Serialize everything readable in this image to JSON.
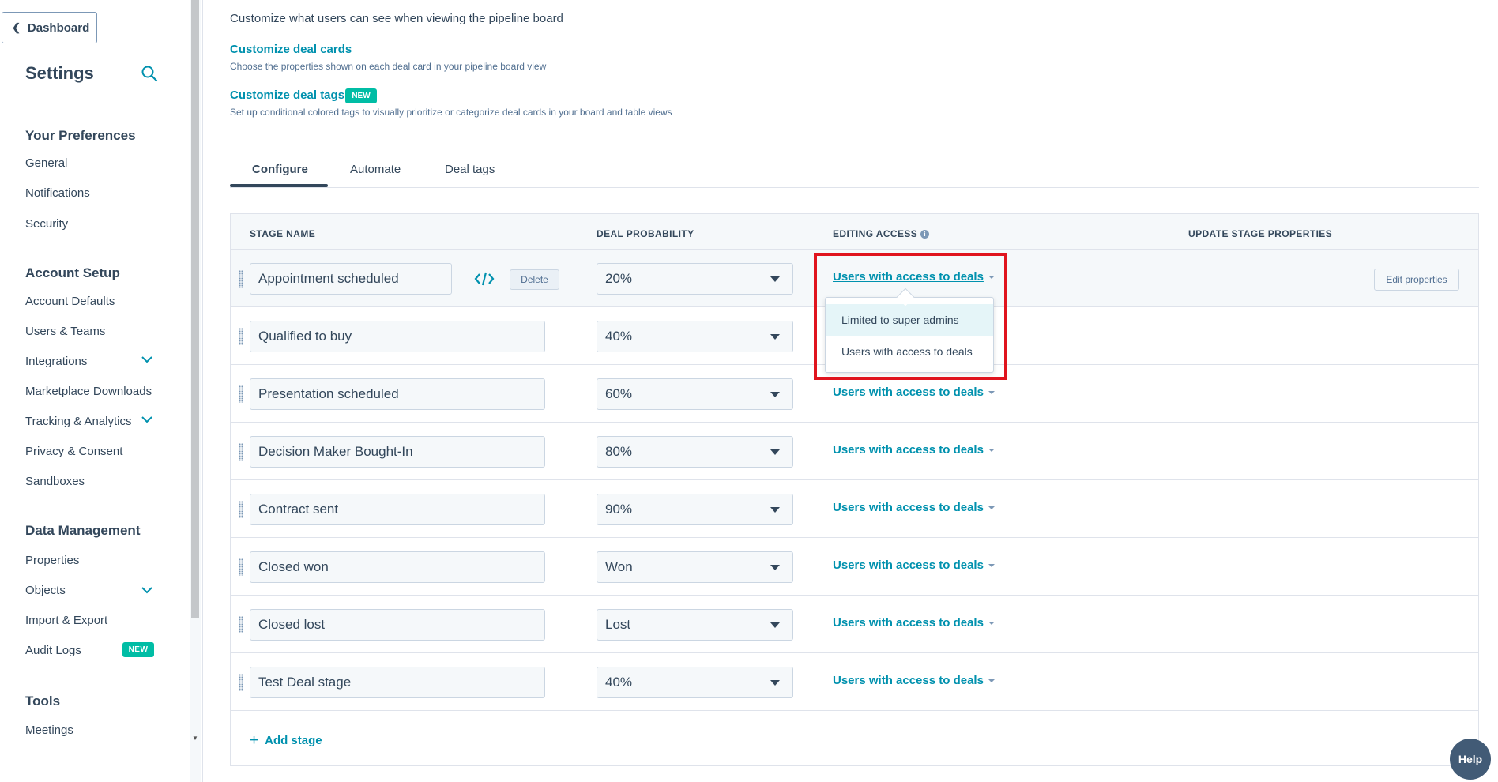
{
  "sidebar": {
    "back_label": "Dashboard",
    "title": "Settings",
    "sections": [
      {
        "title": "Your Preferences",
        "items": [
          "General",
          "Notifications",
          "Security"
        ]
      },
      {
        "title": "Account Setup",
        "items": [
          "Account Defaults",
          "Users & Teams",
          "Integrations",
          "Marketplace Downloads",
          "Tracking & Analytics",
          "Privacy & Consent",
          "Sandboxes"
        ]
      },
      {
        "title": "Data Management",
        "items": [
          "Properties",
          "Objects",
          "Import & Export",
          "Audit Logs"
        ]
      },
      {
        "title": "Tools",
        "items": [
          "Meetings"
        ]
      }
    ],
    "new_badge": "NEW"
  },
  "main": {
    "intro": "Customize what users can see when viewing the pipeline board",
    "customize_cards_title": "Customize deal cards",
    "customize_cards_desc": "Choose the properties shown on each deal card in your pipeline board view",
    "customize_tags_title": "Customize deal tags",
    "customize_tags_badge": "NEW",
    "customize_tags_desc": "Set up conditional colored tags to visually prioritize or categorize deal cards in your board and table views",
    "tabs": [
      "Configure",
      "Automate",
      "Deal tags"
    ],
    "table": {
      "headers": [
        "STAGE NAME",
        "DEAL PROBABILITY",
        "EDITING ACCESS",
        "UPDATE STAGE PROPERTIES"
      ],
      "rows": [
        {
          "stage": "Appointment scheduled",
          "probability": "20%",
          "access": "Users with access to deals"
        },
        {
          "stage": "Qualified to buy",
          "probability": "40%",
          "access": "Users with access to deals"
        },
        {
          "stage": "Presentation scheduled",
          "probability": "60%",
          "access": "Users with access to deals"
        },
        {
          "stage": "Decision Maker Bought-In",
          "probability": "80%",
          "access": "Users with access to deals"
        },
        {
          "stage": "Contract sent",
          "probability": "90%",
          "access": "Users with access to deals"
        },
        {
          "stage": "Closed won",
          "probability": "Won",
          "access": "Users with access to deals"
        },
        {
          "stage": "Closed lost",
          "probability": "Lost",
          "access": "Users with access to deals"
        },
        {
          "stage": "Test Deal stage",
          "probability": "40%",
          "access": "Users with access to deals"
        }
      ],
      "delete_label": "Delete",
      "edit_properties_label": "Edit properties",
      "add_stage_label": "Add stage"
    },
    "dropdown_options": [
      "Limited to super admins",
      "Users with access to deals"
    ]
  },
  "help_label": "Help",
  "colors": {
    "link": "#0091ae",
    "badge": "#00bda5",
    "highlight": "#e0141e"
  }
}
